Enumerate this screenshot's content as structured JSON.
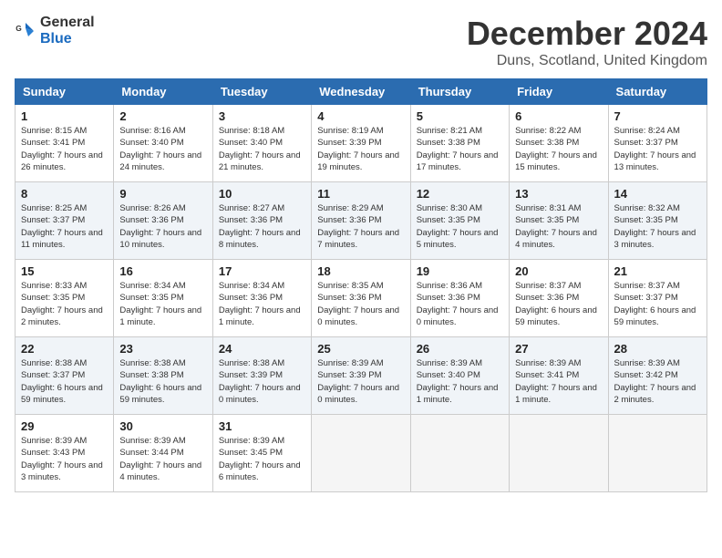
{
  "logo": {
    "general": "General",
    "blue": "Blue"
  },
  "header": {
    "month": "December 2024",
    "location": "Duns, Scotland, United Kingdom"
  },
  "weekdays": [
    "Sunday",
    "Monday",
    "Tuesday",
    "Wednesday",
    "Thursday",
    "Friday",
    "Saturday"
  ],
  "weeks": [
    [
      {
        "day": "1",
        "sunrise": "8:15 AM",
        "sunset": "3:41 PM",
        "daylight": "7 hours and 26 minutes."
      },
      {
        "day": "2",
        "sunrise": "8:16 AM",
        "sunset": "3:40 PM",
        "daylight": "7 hours and 24 minutes."
      },
      {
        "day": "3",
        "sunrise": "8:18 AM",
        "sunset": "3:40 PM",
        "daylight": "7 hours and 21 minutes."
      },
      {
        "day": "4",
        "sunrise": "8:19 AM",
        "sunset": "3:39 PM",
        "daylight": "7 hours and 19 minutes."
      },
      {
        "day": "5",
        "sunrise": "8:21 AM",
        "sunset": "3:38 PM",
        "daylight": "7 hours and 17 minutes."
      },
      {
        "day": "6",
        "sunrise": "8:22 AM",
        "sunset": "3:38 PM",
        "daylight": "7 hours and 15 minutes."
      },
      {
        "day": "7",
        "sunrise": "8:24 AM",
        "sunset": "3:37 PM",
        "daylight": "7 hours and 13 minutes."
      }
    ],
    [
      {
        "day": "8",
        "sunrise": "8:25 AM",
        "sunset": "3:37 PM",
        "daylight": "7 hours and 11 minutes."
      },
      {
        "day": "9",
        "sunrise": "8:26 AM",
        "sunset": "3:36 PM",
        "daylight": "7 hours and 10 minutes."
      },
      {
        "day": "10",
        "sunrise": "8:27 AM",
        "sunset": "3:36 PM",
        "daylight": "7 hours and 8 minutes."
      },
      {
        "day": "11",
        "sunrise": "8:29 AM",
        "sunset": "3:36 PM",
        "daylight": "7 hours and 7 minutes."
      },
      {
        "day": "12",
        "sunrise": "8:30 AM",
        "sunset": "3:35 PM",
        "daylight": "7 hours and 5 minutes."
      },
      {
        "day": "13",
        "sunrise": "8:31 AM",
        "sunset": "3:35 PM",
        "daylight": "7 hours and 4 minutes."
      },
      {
        "day": "14",
        "sunrise": "8:32 AM",
        "sunset": "3:35 PM",
        "daylight": "7 hours and 3 minutes."
      }
    ],
    [
      {
        "day": "15",
        "sunrise": "8:33 AM",
        "sunset": "3:35 PM",
        "daylight": "7 hours and 2 minutes."
      },
      {
        "day": "16",
        "sunrise": "8:34 AM",
        "sunset": "3:35 PM",
        "daylight": "7 hours and 1 minute."
      },
      {
        "day": "17",
        "sunrise": "8:34 AM",
        "sunset": "3:36 PM",
        "daylight": "7 hours and 1 minute."
      },
      {
        "day": "18",
        "sunrise": "8:35 AM",
        "sunset": "3:36 PM",
        "daylight": "7 hours and 0 minutes."
      },
      {
        "day": "19",
        "sunrise": "8:36 AM",
        "sunset": "3:36 PM",
        "daylight": "7 hours and 0 minutes."
      },
      {
        "day": "20",
        "sunrise": "8:37 AM",
        "sunset": "3:36 PM",
        "daylight": "6 hours and 59 minutes."
      },
      {
        "day": "21",
        "sunrise": "8:37 AM",
        "sunset": "3:37 PM",
        "daylight": "6 hours and 59 minutes."
      }
    ],
    [
      {
        "day": "22",
        "sunrise": "8:38 AM",
        "sunset": "3:37 PM",
        "daylight": "6 hours and 59 minutes."
      },
      {
        "day": "23",
        "sunrise": "8:38 AM",
        "sunset": "3:38 PM",
        "daylight": "6 hours and 59 minutes."
      },
      {
        "day": "24",
        "sunrise": "8:38 AM",
        "sunset": "3:39 PM",
        "daylight": "7 hours and 0 minutes."
      },
      {
        "day": "25",
        "sunrise": "8:39 AM",
        "sunset": "3:39 PM",
        "daylight": "7 hours and 0 minutes."
      },
      {
        "day": "26",
        "sunrise": "8:39 AM",
        "sunset": "3:40 PM",
        "daylight": "7 hours and 1 minute."
      },
      {
        "day": "27",
        "sunrise": "8:39 AM",
        "sunset": "3:41 PM",
        "daylight": "7 hours and 1 minute."
      },
      {
        "day": "28",
        "sunrise": "8:39 AM",
        "sunset": "3:42 PM",
        "daylight": "7 hours and 2 minutes."
      }
    ],
    [
      {
        "day": "29",
        "sunrise": "8:39 AM",
        "sunset": "3:43 PM",
        "daylight": "7 hours and 3 minutes."
      },
      {
        "day": "30",
        "sunrise": "8:39 AM",
        "sunset": "3:44 PM",
        "daylight": "7 hours and 4 minutes."
      },
      {
        "day": "31",
        "sunrise": "8:39 AM",
        "sunset": "3:45 PM",
        "daylight": "7 hours and 6 minutes."
      },
      null,
      null,
      null,
      null
    ]
  ]
}
